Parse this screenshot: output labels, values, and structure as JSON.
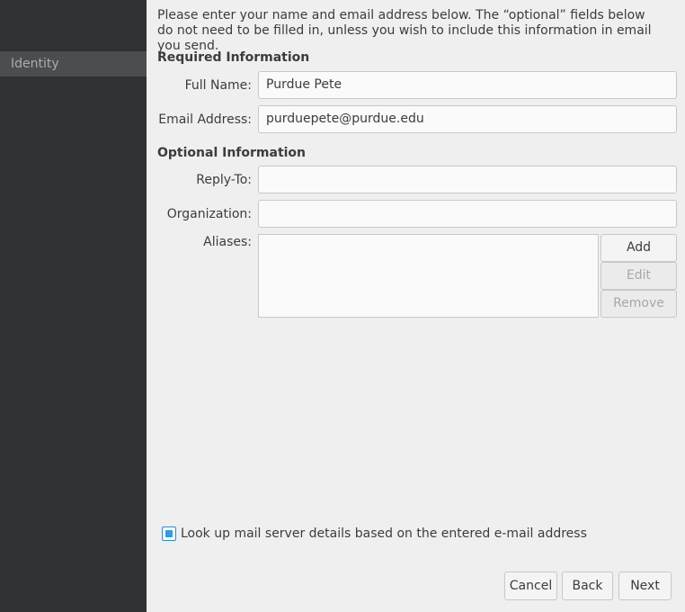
{
  "sidebar": {
    "items": [
      {
        "label": "Identity",
        "selected": true
      }
    ]
  },
  "intro_text": "Please enter your name and email address below. The “optional” fields below do not need to be filled in, unless you wish to include this information in email you send.",
  "required": {
    "title": "Required Information",
    "full_name_label": "Full Name:",
    "full_name_value": "Purdue Pete",
    "email_label": "Email Address:",
    "email_value": "purduepete@purdue.edu"
  },
  "optional": {
    "title": "Optional Information",
    "reply_to_label": "Reply-To:",
    "reply_to_value": "",
    "organization_label": "Organization:",
    "organization_value": "",
    "aliases_label": "Aliases:",
    "add_label": "Add",
    "edit_label": "Edit",
    "remove_label": "Remove"
  },
  "lookup": {
    "label": "Look up mail server details based on the entered e-mail address",
    "checked": true
  },
  "buttons": {
    "cancel": "Cancel",
    "back": "Back",
    "next": "Next"
  },
  "colors": {
    "sidebar_bg": "#2f3234",
    "sidebar_selected": "#4b4e50",
    "accent": "#2f9ce4",
    "window_bg": "#efeff0"
  }
}
